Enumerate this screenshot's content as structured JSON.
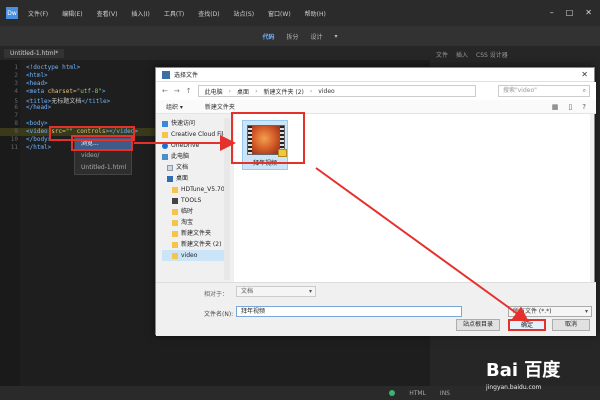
{
  "menubar": {
    "app_icon": "Dw",
    "items": [
      "文件(F)",
      "编辑(E)",
      "查看(V)",
      "插入(I)",
      "工具(T)",
      "查找(D)",
      "站点(S)",
      "窗口(W)",
      "帮助(H)"
    ]
  },
  "toolbar": {
    "items": [
      "代码",
      "拆分",
      "设计"
    ],
    "active": "代码"
  },
  "doc_tabs": [
    "Untitled-1.html*"
  ],
  "code": {
    "lines": [
      {
        "n": "1",
        "parts": [
          [
            "tag",
            "<!doctype html>"
          ]
        ]
      },
      {
        "n": "2",
        "parts": [
          [
            "tag",
            "<html>"
          ]
        ]
      },
      {
        "n": "3",
        "parts": [
          [
            "tag",
            "<head>"
          ]
        ]
      },
      {
        "n": "4",
        "parts": [
          [
            "tag",
            "<meta "
          ],
          [
            "attr",
            "charset="
          ],
          [
            "str",
            "\"utf-8\""
          ],
          [
            "tag",
            ">"
          ]
        ]
      },
      {
        "n": "5",
        "parts": [
          [
            "tag",
            "<title>"
          ],
          [
            "plain",
            "无标题文档"
          ],
          [
            "tag",
            "</title>"
          ]
        ]
      },
      {
        "n": "6",
        "parts": [
          [
            "tag",
            "</head>"
          ]
        ]
      },
      {
        "n": "7",
        "parts": []
      },
      {
        "n": "8",
        "parts": [
          [
            "tag",
            "<body>"
          ]
        ]
      },
      {
        "n": "9",
        "parts": [
          [
            "tag",
            "<video "
          ],
          [
            "attr",
            "src="
          ],
          [
            "str",
            "\"\""
          ],
          [
            "attr",
            " controls"
          ],
          [
            "tag",
            "></video>"
          ]
        ]
      },
      {
        "n": "10",
        "parts": [
          [
            "tag",
            "</body>"
          ]
        ]
      },
      {
        "n": "11",
        "parts": [
          [
            "tag",
            "</html>"
          ]
        ]
      }
    ]
  },
  "hint_popup": {
    "items": [
      "浏览...",
      "video/",
      "Untitled-1.html"
    ],
    "selected": "浏览..."
  },
  "right_panel": {
    "tabs": [
      "文件",
      "插入",
      "CSS 设计器"
    ]
  },
  "statusbar": {
    "mode": "HTML",
    "size": "INS"
  },
  "dialog": {
    "title": "选择文件",
    "close": "✕",
    "breadcrumb": [
      "此电脑",
      "桌面",
      "新建文件夹 (2)",
      "video"
    ],
    "search_placeholder": "搜索\"video\"",
    "commands": [
      "组织 ▾",
      "新建文件夹"
    ],
    "nav_items": [
      {
        "icon": "star",
        "label": "快速访问"
      },
      {
        "icon": "folder",
        "label": "Creative Cloud Files"
      },
      {
        "icon": "cloud",
        "label": "OneDrive"
      },
      {
        "icon": "pc",
        "label": "此电脑"
      },
      {
        "icon": "doc",
        "label": "文档"
      },
      {
        "icon": "desk",
        "label": "桌面"
      },
      {
        "icon": "folder",
        "label": "HDTune_V5.70"
      },
      {
        "icon": "dark",
        "label": "TOOLS"
      },
      {
        "icon": "folder",
        "label": "临时"
      },
      {
        "icon": "folder",
        "label": "淘宝"
      },
      {
        "icon": "folder",
        "label": "新建文件夹"
      },
      {
        "icon": "folder",
        "label": "新建文件夹 (2)"
      },
      {
        "icon": "folder",
        "label": "video"
      }
    ],
    "nav_selected": "video",
    "file": {
      "name": "拜年视频"
    },
    "filetype_label": "相对于：",
    "filetype_value": "文档",
    "filename_label": "文件名(N):",
    "filename_value": "拜年视频",
    "filter_value": "所有文件 (*.*)",
    "buttons": {
      "site_root": "站点根目录",
      "ok": "确定",
      "cancel": "取消"
    }
  },
  "watermark": {
    "logo": "Bai 百度",
    "url": "jingyan.baidu.com"
  }
}
